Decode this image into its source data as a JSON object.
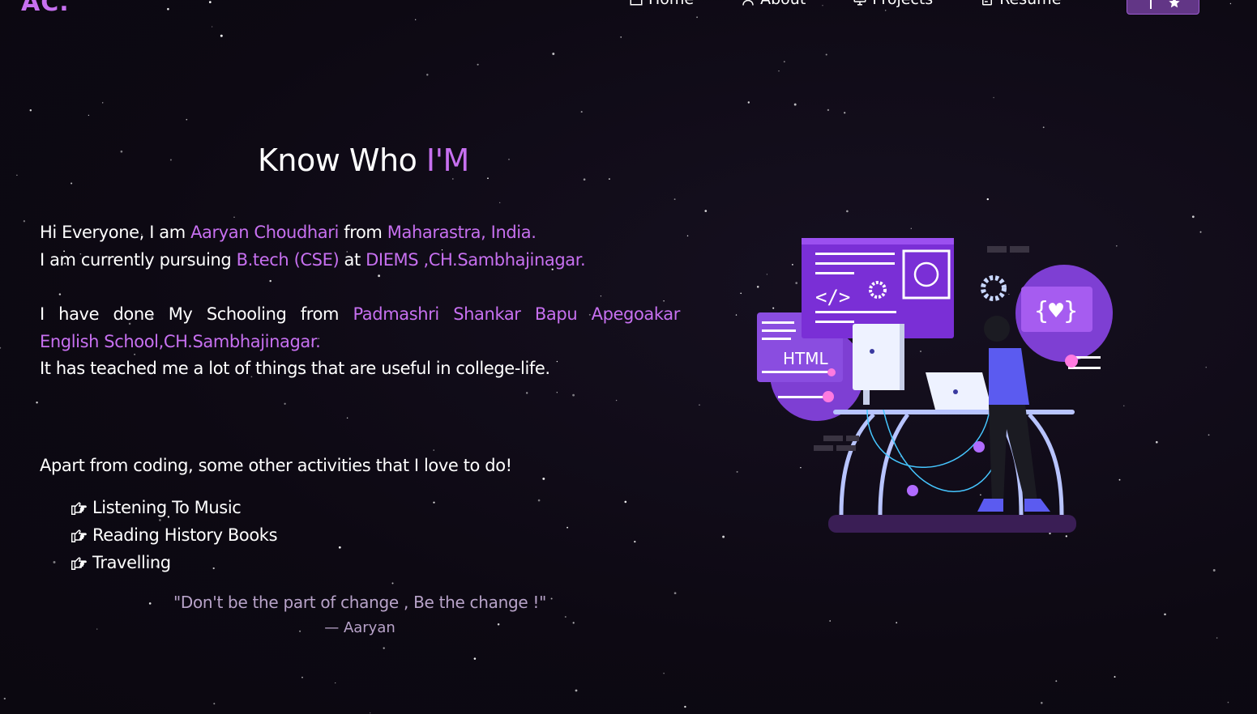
{
  "brand": {
    "logo": "AC."
  },
  "nav": {
    "items": [
      {
        "label": "Home",
        "icon": "home-icon"
      },
      {
        "label": "About",
        "icon": "user-icon"
      },
      {
        "label": "Projects",
        "icon": "projects-icon"
      },
      {
        "label": "Resume",
        "icon": "document-icon"
      }
    ],
    "fork_icons": [
      "git-fork-icon",
      "star-icon"
    ]
  },
  "about": {
    "heading_prefix": "Know Who ",
    "heading_highlight": "I'M",
    "intro": {
      "t1": "Hi Everyone, I am ",
      "name": "Aaryan Choudhari",
      "t2": " from ",
      "place": "Maharastra, India.",
      "t3": "I am currently pursuing ",
      "degree": "B.tech (CSE)",
      "t4": " at ",
      "college": "DIEMS ,CH.Sambhajinagar."
    },
    "schooling": {
      "t1": "I have done My Schooling from ",
      "school_a": "Padmashri Shankar Bapu Apegoakar",
      "school_b": "English School,CH.Sambhajinagar.",
      "t2": "It has teached me a lot of things that are useful in college-life."
    },
    "activities_intro": "Apart from coding, some other activities that I love to do!",
    "activities": [
      "Listening To Music",
      "Reading History Books",
      "Travelling"
    ],
    "quote": "\"Don't be the part of change , Be the change !\"",
    "author": "— Aaryan"
  },
  "illustration": {
    "html_label": "HTML"
  },
  "colors": {
    "accent": "#c770f0",
    "background": "#0e0a14",
    "quote": "#b8a3c9"
  }
}
